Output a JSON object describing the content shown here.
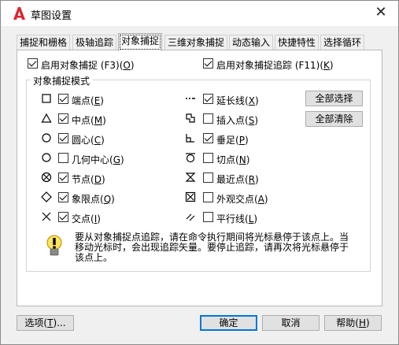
{
  "window": {
    "title": "草图设置",
    "close_glyph": "✕"
  },
  "tabs": [
    {
      "label": "捕捉和栅格",
      "active": false
    },
    {
      "label": "极轴追踪",
      "active": false
    },
    {
      "label": "对象捕捉",
      "active": true
    },
    {
      "label": "三维对象捕捉",
      "active": false
    },
    {
      "label": "动态输入",
      "active": false
    },
    {
      "label": "快捷特性",
      "active": false
    },
    {
      "label": "选择循环",
      "active": false
    }
  ],
  "top_options": {
    "enable_osnap": {
      "text": "启用对象捕捉 (F3)(",
      "key": "O",
      "tail": ")",
      "checked": true
    },
    "enable_tracking": {
      "text": "启用对象捕捉追踪 (F11)(",
      "key": "K",
      "tail": ")",
      "checked": true
    }
  },
  "group_title": "对象捕捉模式",
  "left_modes": [
    {
      "name": "端点",
      "key": "E",
      "checked": true,
      "icon": "endpoint-icon"
    },
    {
      "name": "中点",
      "key": "M",
      "checked": true,
      "icon": "midpoint-icon"
    },
    {
      "name": "圆心",
      "key": "C",
      "checked": true,
      "icon": "center-icon"
    },
    {
      "name": "几何中心",
      "key": "G",
      "checked": false,
      "icon": "geometric-center-icon"
    },
    {
      "name": "节点",
      "key": "D",
      "checked": true,
      "icon": "node-icon"
    },
    {
      "name": "象限点",
      "key": "Q",
      "checked": true,
      "icon": "quadrant-icon"
    },
    {
      "name": "交点",
      "key": "I",
      "checked": true,
      "icon": "intersection-icon"
    }
  ],
  "right_modes": [
    {
      "name": "延长线",
      "key": "X",
      "checked": true,
      "icon": "extension-icon"
    },
    {
      "name": "插入点",
      "key": "S",
      "checked": false,
      "icon": "insertion-icon"
    },
    {
      "name": "垂足",
      "key": "P",
      "checked": true,
      "icon": "perpendicular-icon"
    },
    {
      "name": "切点",
      "key": "N",
      "checked": false,
      "icon": "tangent-icon"
    },
    {
      "name": "最近点",
      "key": "R",
      "checked": false,
      "icon": "nearest-icon"
    },
    {
      "name": "外观交点",
      "key": "A",
      "checked": false,
      "icon": "apparent-intersection-icon"
    },
    {
      "name": "平行线",
      "key": "L",
      "checked": false,
      "icon": "parallel-icon"
    }
  ],
  "side_buttons": {
    "select_all": "全部选择",
    "clear_all": "全部清除"
  },
  "info": {
    "icon": "lightbulb-icon",
    "text": "要从对象捕捉点追踪，请在命令执行期间将光标悬停于该点上。当移动光标时，会出现追踪矢量。要停止追踪，请再次将光标悬停于该点上。"
  },
  "footer": {
    "options": {
      "text": "选项(",
      "key": "T",
      "tail": ")..."
    },
    "ok": "确定",
    "cancel": "取消",
    "help": {
      "text": "帮助(",
      "key": "H",
      "tail": ")"
    }
  }
}
